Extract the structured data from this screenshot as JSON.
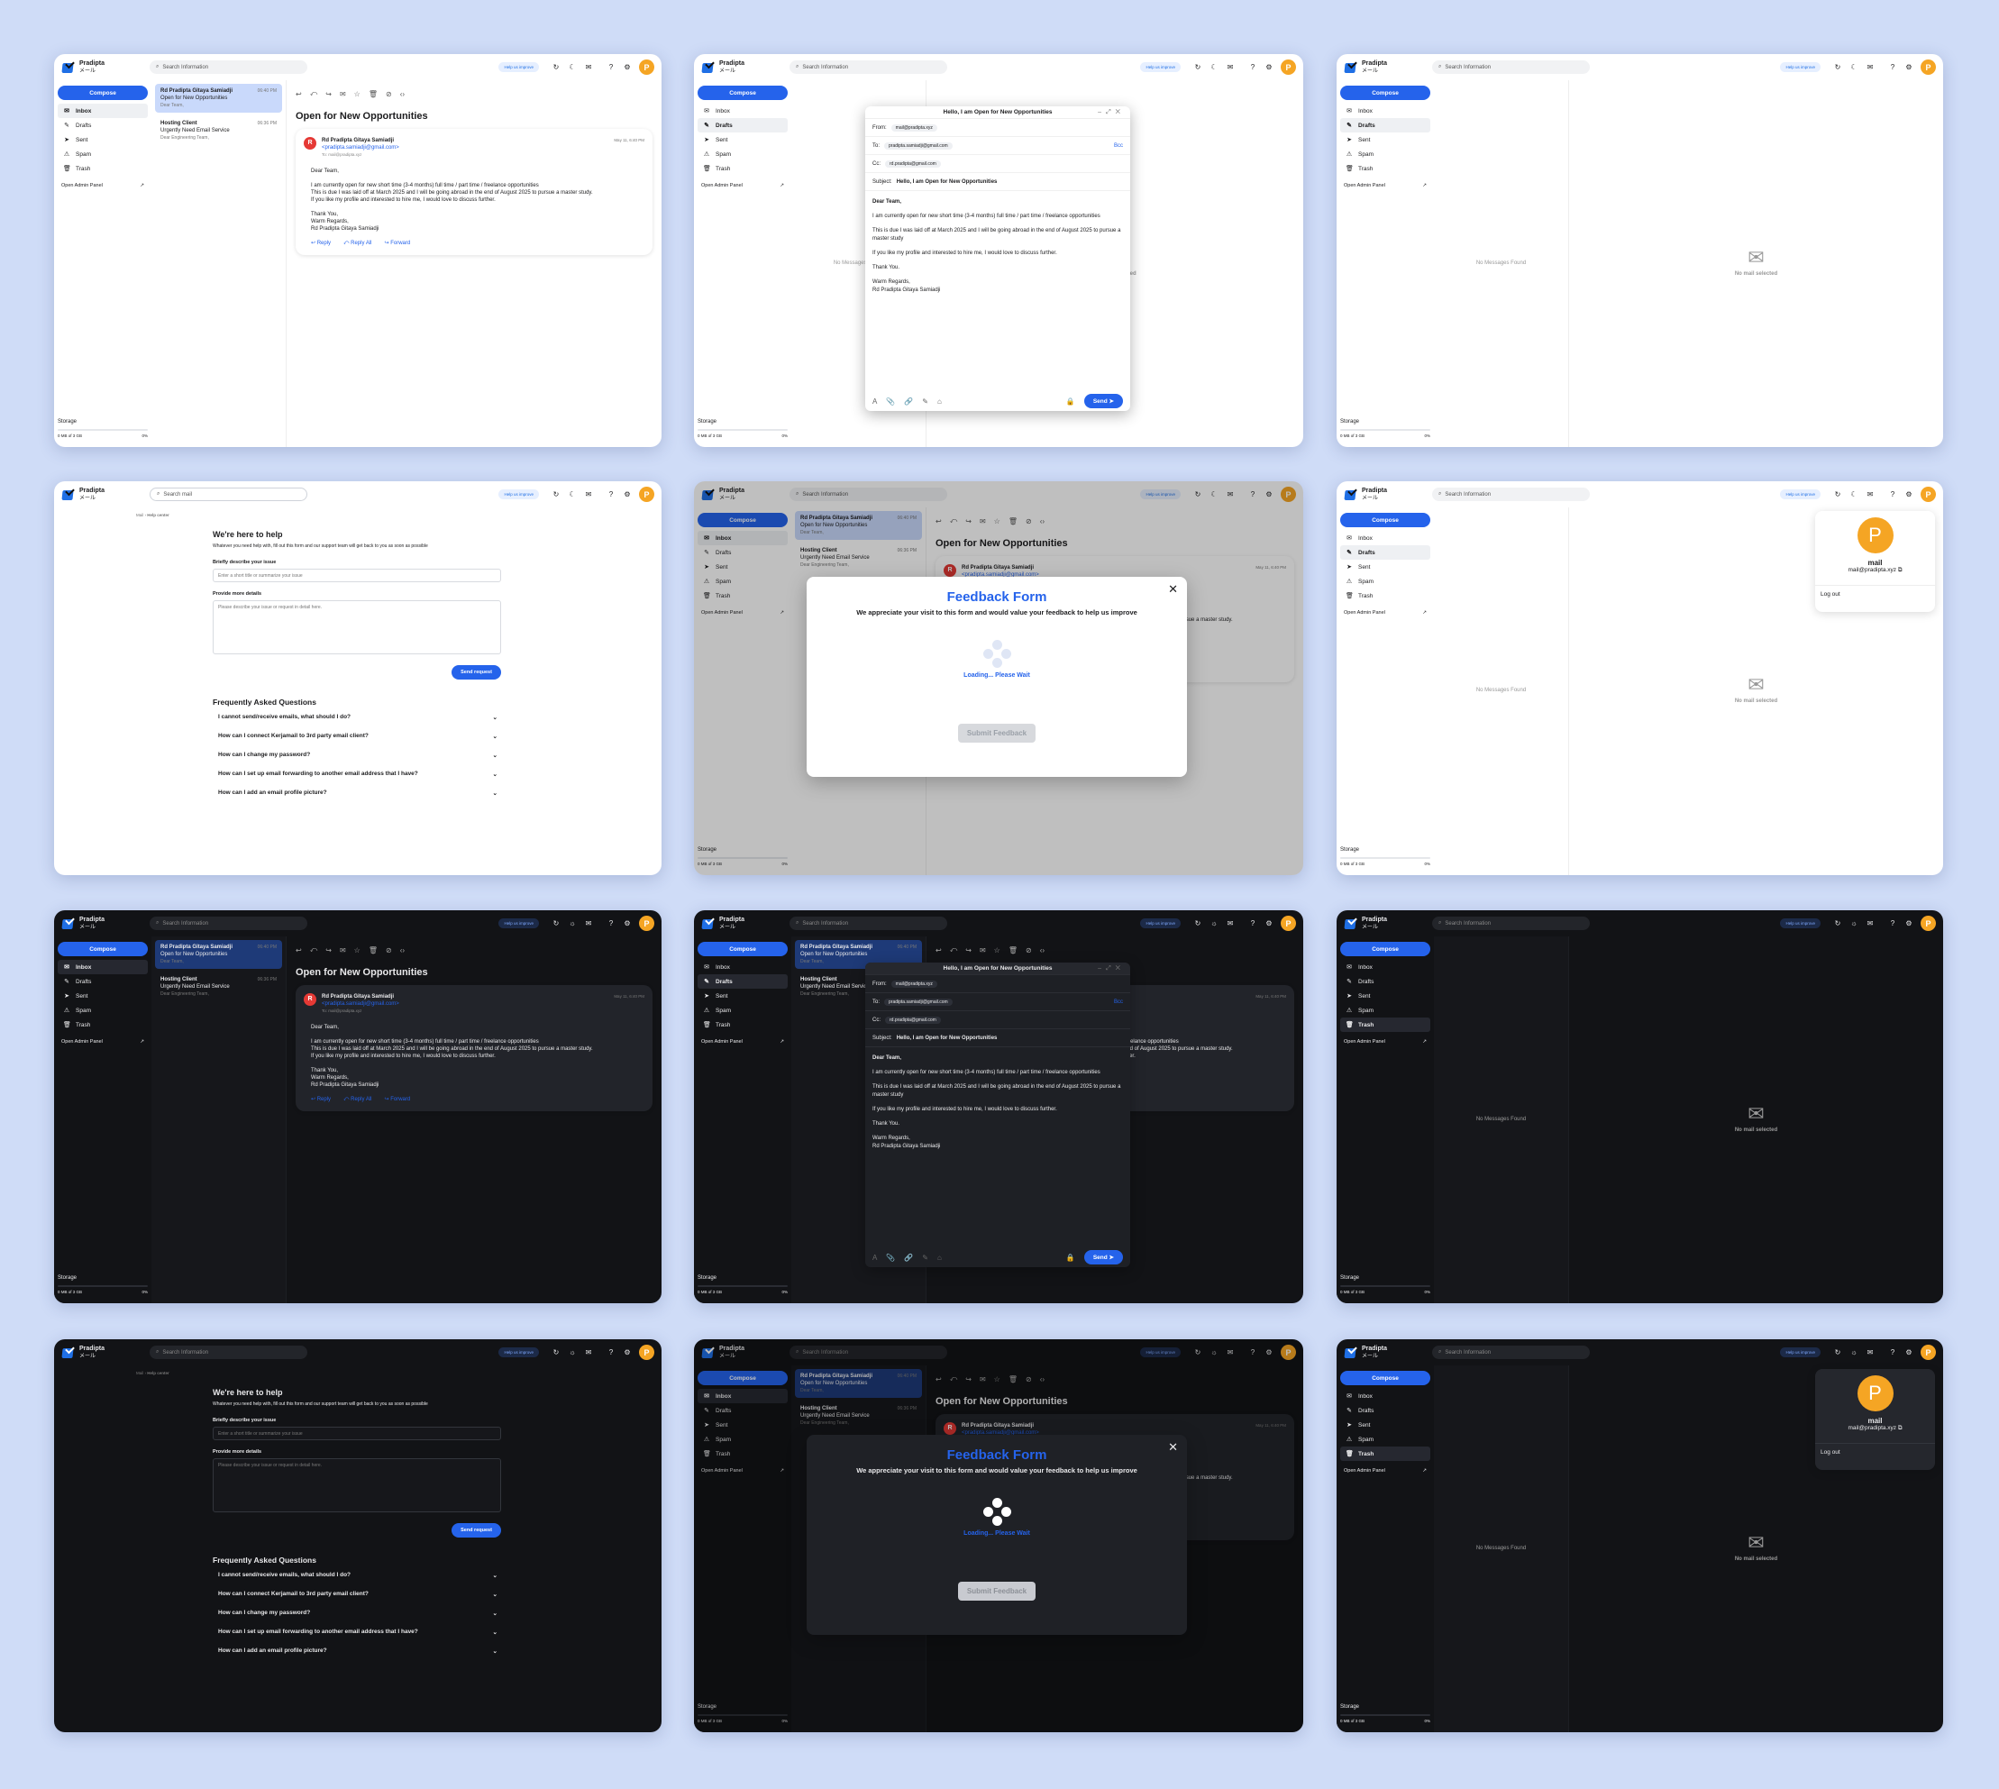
{
  "app": {
    "name": "Pradipta",
    "subtitle": "メール",
    "avatar": "P",
    "search_placeholder": "Search Information",
    "help_improve": "Help us improve",
    "search_mail": "Search mail"
  },
  "sidebar": {
    "compose": "Compose",
    "items": [
      "Inbox",
      "Drafts",
      "Sent",
      "Spam",
      "Trash"
    ],
    "admin": "Open Admin Panel",
    "storage": "Storage",
    "storage_used": "0 MB of 3 GB",
    "storage_pct": "0%"
  },
  "emails": [
    {
      "from": "Rd Pradipta Gitaya Samiadji",
      "time": "06:40 PM",
      "subject": "Open for New Opportunities",
      "preview": "Dear Team,"
    },
    {
      "from": "Hosting Client",
      "time": "06:36 PM",
      "subject": "Urgently Need Email Service",
      "preview": "Dear Engineering Team,"
    }
  ],
  "message": {
    "subject": "Open for New Opportunities",
    "sender": "Rd Pradipta Gitaya Samiadji",
    "sender_email": "<pradipta.samiadji@gmail.com>",
    "to": "To: mail@pradipta.xyz",
    "date": "May 11, 6:40 PM",
    "greeting": "Dear Team,",
    "line1": "I am currently open for new short time (3-4 months) full time / part time / freelance opportunities",
    "line2": "This is due I was laid off at March 2025 and I will be going abroad in the end of August 2025 to pursue a master study.",
    "line3": "If you like my profile and interested to hire me, I would love to discuss further.",
    "thanks": "Thank You,",
    "regards": "Warm Regards,",
    "sign": "Rd Pradipta Gitaya Samiadji",
    "reply": "Reply",
    "reply_all": "Reply All",
    "forward": "Forward"
  },
  "compose_window": {
    "title": "Hello, I am Open for New Opportunities",
    "from_label": "From:",
    "from": "mail@pradipta.xyz",
    "to_label": "To:",
    "to": "pradipta.samiadji@gmail.com",
    "cc_label": "Cc:",
    "cc": "rd.pradipta@gmail.com",
    "bcc": "Bcc",
    "subject_label": "Subject:",
    "subject": "Hello, I am Open for New Opportunities",
    "greeting": "Dear Team,",
    "p1": "I am currently open for new short time (3-4 months) full time / part time / freelance opportunities",
    "p2": "This is due I was laid off at March 2025 and I will be going abroad in the end of August 2025 to pursue a master study",
    "p3": "If you like my profile and interested to hire me, I would love to discuss further.",
    "thanks": "Thank You.",
    "regards": "Warm Regards,",
    "sign": "Rd Pradipta Gitaya Samiadji",
    "send": "Send"
  },
  "empty": {
    "no_messages": "No Messages Found",
    "no_selected": "No mail selected"
  },
  "feedback": {
    "title": "Feedback Form",
    "subtitle": "We appreciate your visit to this form and would value your feedback to help us improve",
    "loading": "Loading... Please Wait",
    "submit": "Submit Feedback"
  },
  "help": {
    "breadcrumb_root": "Mail",
    "breadcrumb_current": "Help center",
    "title": "We're here to help",
    "intro": "Whatever you need help with, fill out this form and our support team will get back to you as soon as possible",
    "issue_label": "Briefly describe your issue",
    "issue_placeholder": "Enter a short title or summarize your issue",
    "details_label": "Provide more details",
    "details_placeholder": "Please describe your issue or request in detail here.",
    "send": "Send request",
    "faq_title": "Frequently Asked Questions",
    "faqs": [
      "I cannot send/receive emails, what should I do?",
      "How can I connect Kerjamail to 3rd party email client?",
      "How can I change my password?",
      "How can I set up email forwarding to another email address that I have?",
      "How can I add an email profile picture?"
    ]
  },
  "profile": {
    "name": "mail",
    "email": "mail@pradipta.xyz",
    "logout": "Log out"
  },
  "colors": {
    "accent": "#2563eb",
    "avatar": "#f5a524",
    "background": "#cfdcf7"
  }
}
